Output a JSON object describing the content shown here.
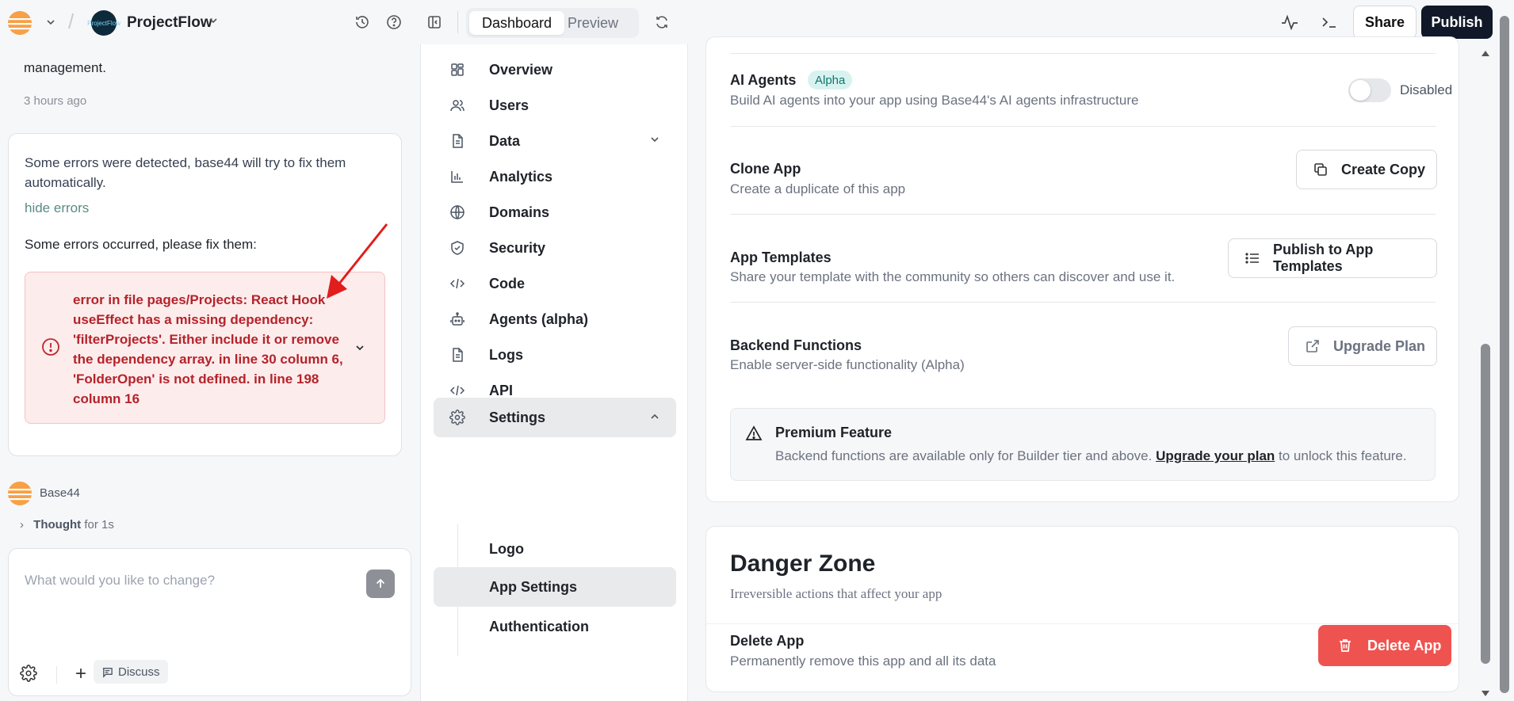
{
  "topbar": {
    "project_name": "ProjectFlow",
    "project_logo_text": "ProjectFlow",
    "tabs": [
      {
        "label": "Dashboard",
        "active": true
      },
      {
        "label": "Preview",
        "active": false
      }
    ],
    "share_label": "Share",
    "publish_label": "Publish"
  },
  "chat": {
    "prev_message_tail": "management.",
    "prev_message_time": "3 hours ago",
    "error_card": {
      "intro": "Some errors were detected, base44 will try to fix them automatically.",
      "toggle_label": "hide errors",
      "subtitle": "Some errors occurred, please fix them:",
      "error_text": "error in file pages/Projects: React Hook useEffect has a missing dependency: 'filterProjects'. Either include it or remove the dependency array. in line 30 column 6, 'FolderOpen' is not defined. in line 198 column 16"
    },
    "bot_name": "Base44",
    "thought_label": "Thought",
    "thought_duration": "for 1s",
    "composer_placeholder": "What would you like to change?",
    "discuss_label": "Discuss"
  },
  "nav": {
    "items": [
      {
        "label": "Overview",
        "icon": "grid-icon"
      },
      {
        "label": "Users",
        "icon": "users-icon"
      },
      {
        "label": "Data",
        "icon": "document-icon"
      },
      {
        "label": "Analytics",
        "icon": "bar-chart-icon"
      },
      {
        "label": "Domains",
        "icon": "globe-icon"
      },
      {
        "label": "Security",
        "icon": "shield-icon"
      },
      {
        "label": "Code",
        "icon": "code-icon"
      },
      {
        "label": "Agents (alpha)",
        "icon": "bot-icon"
      },
      {
        "label": "Logs",
        "icon": "document-icon"
      },
      {
        "label": "API",
        "icon": "code-icon"
      },
      {
        "label": "Settings",
        "icon": "gear-icon"
      }
    ],
    "settings_sub": [
      {
        "label": "Logo",
        "active": false
      },
      {
        "label": "App Settings",
        "active": true
      },
      {
        "label": "Authentication",
        "active": false
      }
    ]
  },
  "main": {
    "ai_agents": {
      "title": "AI Agents",
      "badge": "Alpha",
      "desc": "Build AI agents into your app using Base44's AI agents infrastructure",
      "toggle_label": "Disabled"
    },
    "clone_app": {
      "title": "Clone App",
      "desc": "Create a duplicate of this app",
      "button": "Create Copy"
    },
    "app_templates": {
      "title": "App Templates",
      "desc": "Share your template with the community so others can discover and use it.",
      "button": "Publish to App Templates"
    },
    "backend_functions": {
      "title": "Backend Functions",
      "desc": "Enable server-side functionality (Alpha)",
      "button": "Upgrade Plan"
    },
    "premium": {
      "title": "Premium Feature",
      "desc_before": "Backend functions are available only for Builder tier and above.",
      "link": "Upgrade your plan",
      "desc_after": "to unlock this feature."
    },
    "danger_zone": {
      "title": "Danger Zone",
      "desc": "Irreversible actions that affect your app",
      "delete_title": "Delete App",
      "delete_desc": "Permanently remove this app and all its data",
      "delete_button": "Delete App"
    }
  },
  "colors": {
    "accent_dark": "#111827",
    "danger": "#ef5350",
    "error_text": "#b4232b",
    "alpha_badge_bg": "#d8f3ef"
  }
}
